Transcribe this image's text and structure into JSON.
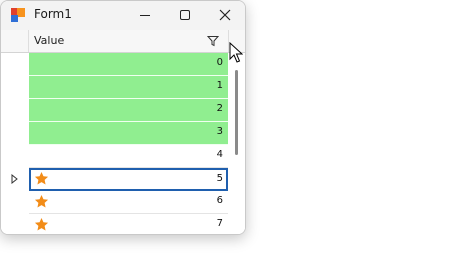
{
  "window": {
    "title": "Form1"
  },
  "grid": {
    "column_header": "Value",
    "rows": [
      {
        "value": "0",
        "highlighted": true
      },
      {
        "value": "1",
        "highlighted": true
      },
      {
        "value": "2",
        "highlighted": true
      },
      {
        "value": "3",
        "highlighted": true
      },
      {
        "value": "4",
        "highlighted": false
      },
      {
        "value": "5",
        "highlighted": false,
        "star": true,
        "focused": true
      },
      {
        "value": "6",
        "highlighted": false,
        "star": true
      },
      {
        "value": "7",
        "highlighted": false,
        "star": true
      }
    ]
  },
  "colors": {
    "highlight": "#90ee90",
    "star": "#f28c18",
    "focus_border": "#1f5fae"
  },
  "icons": {
    "app": "winforms-app-icon",
    "filter": "filter-icon",
    "star": "star-icon",
    "row_indicator": "triangle-right-icon",
    "cursor": "mouse-pointer-icon"
  }
}
